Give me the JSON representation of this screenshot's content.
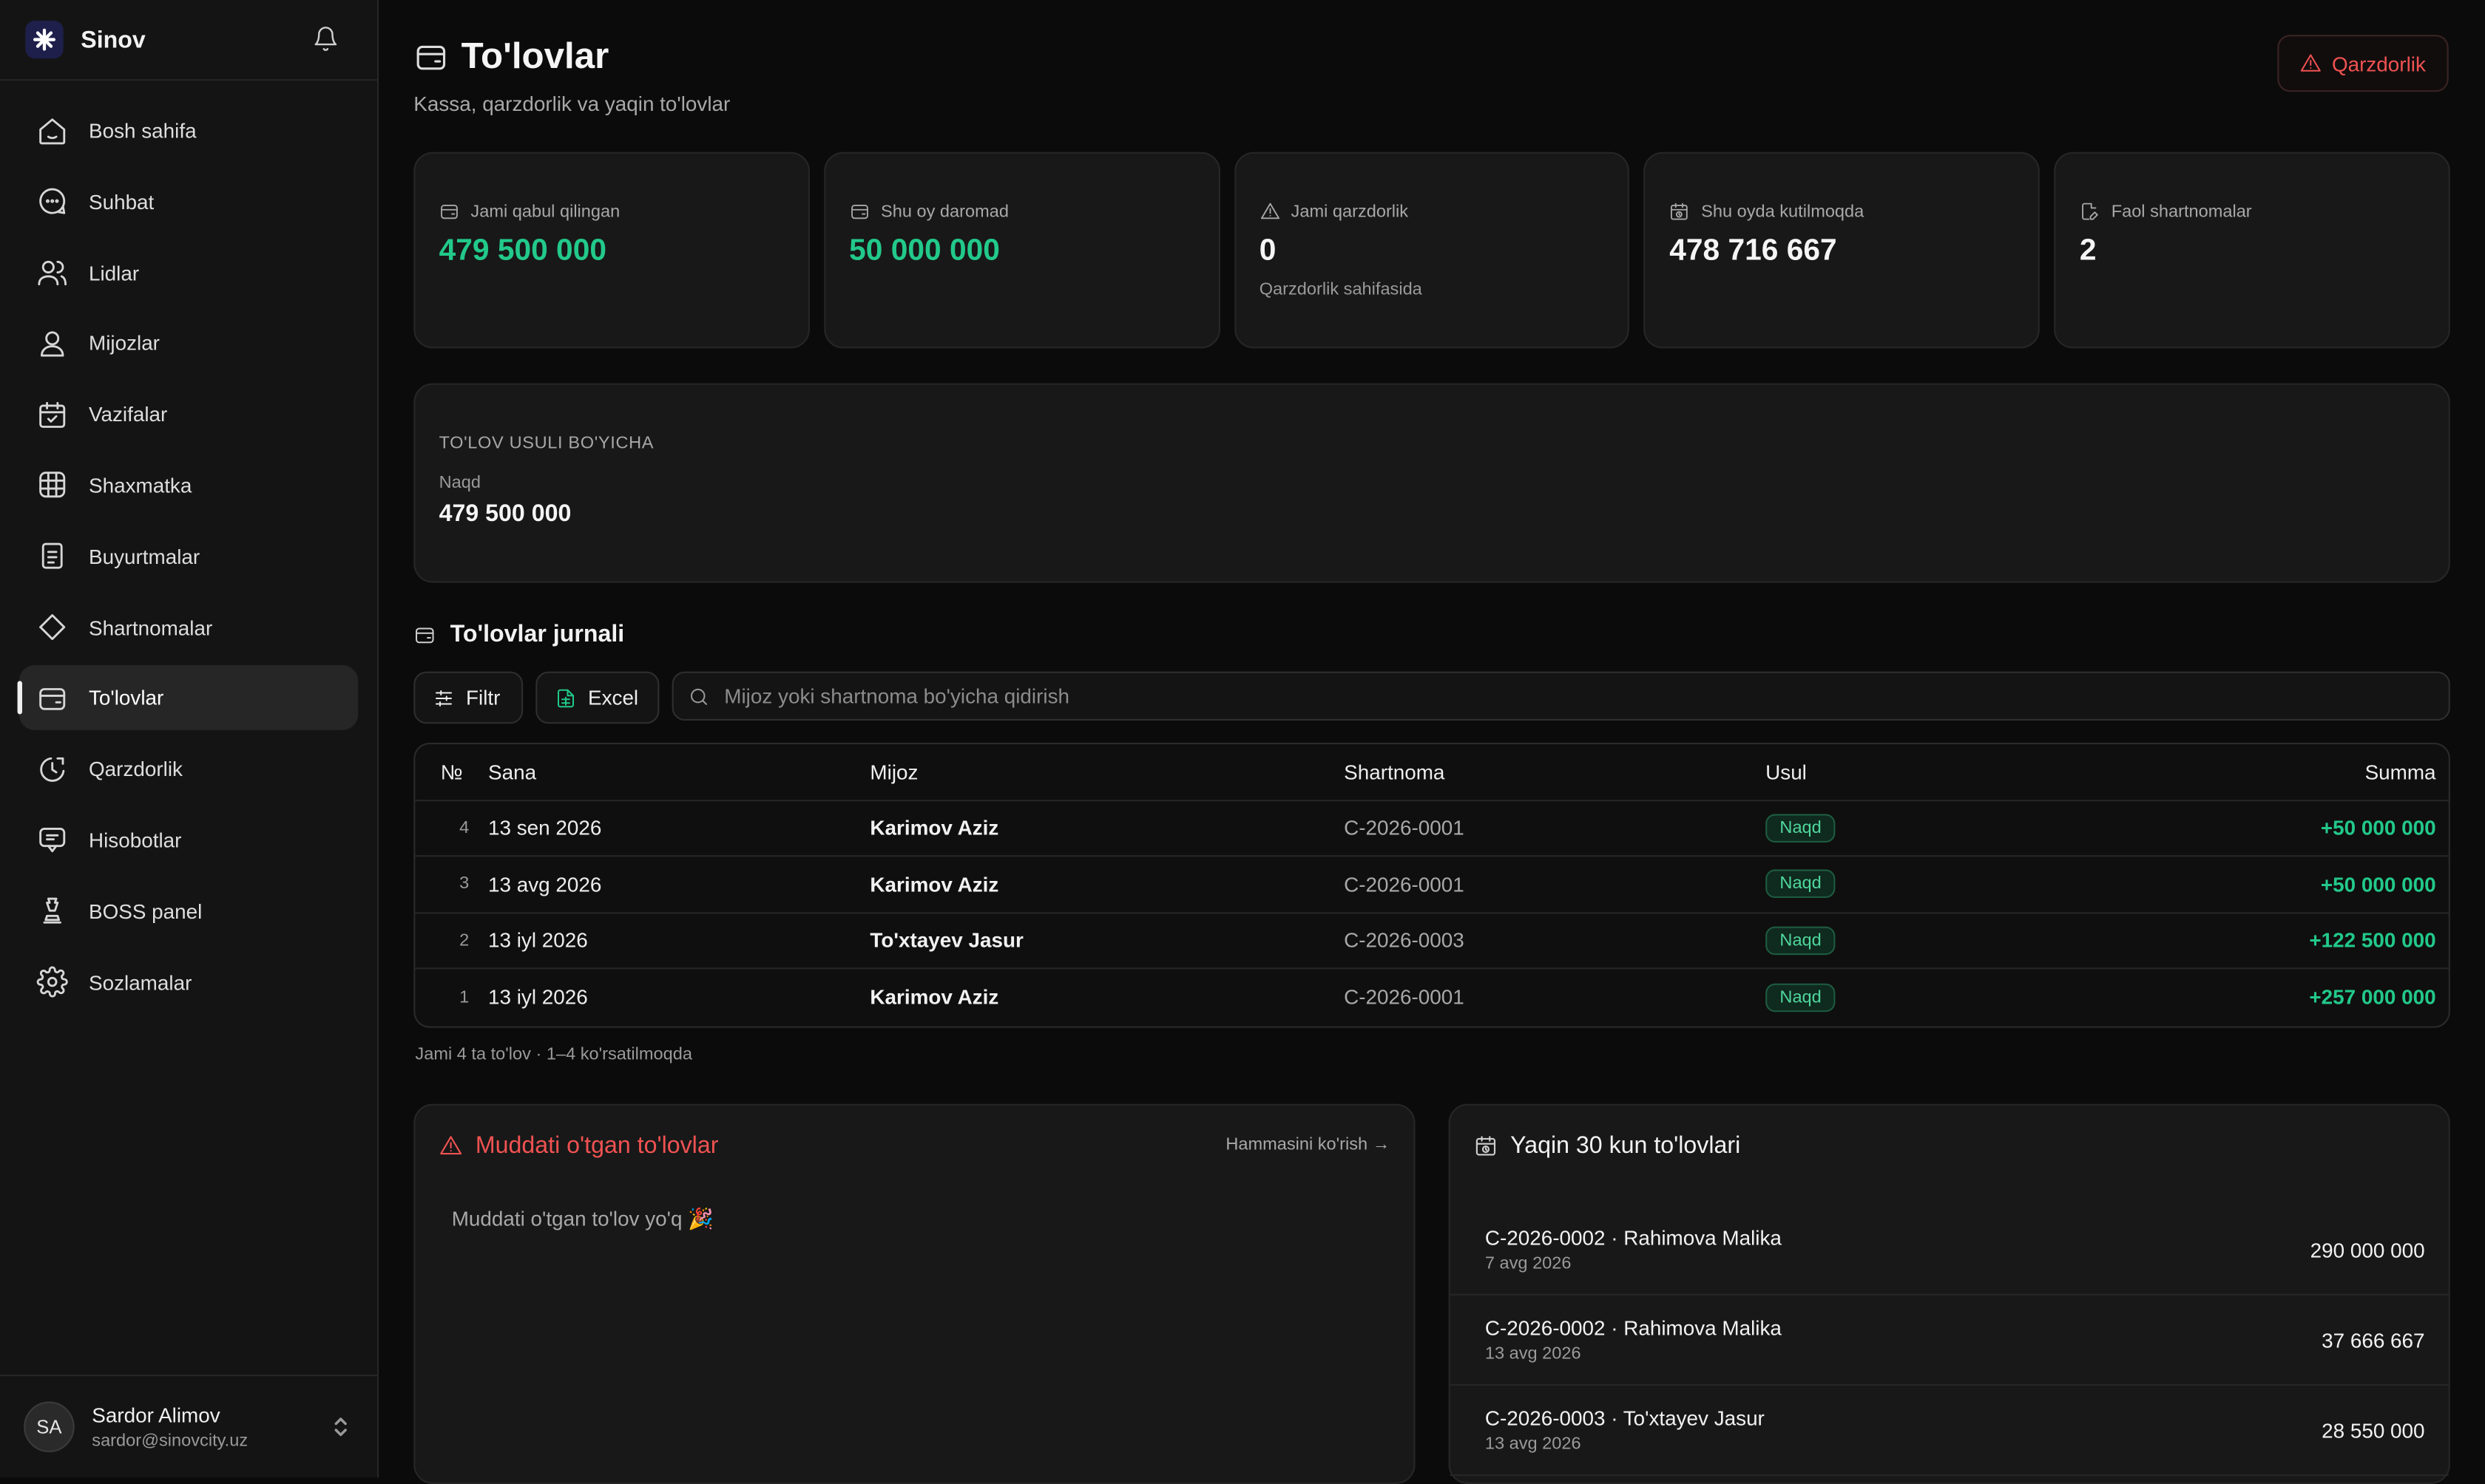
{
  "app": {
    "name": "Sinov"
  },
  "sidebar": {
    "items": [
      {
        "label": "Bosh sahifa",
        "icon": "home-icon"
      },
      {
        "label": "Suhbat",
        "icon": "chat-icon"
      },
      {
        "label": "Lidlar",
        "icon": "users-icon"
      },
      {
        "label": "Mijozlar",
        "icon": "user-icon"
      },
      {
        "label": "Vazifalar",
        "icon": "calendar-check-icon"
      },
      {
        "label": "Shaxmatka",
        "icon": "grid-icon"
      },
      {
        "label": "Buyurtmalar",
        "icon": "clipboard-icon"
      },
      {
        "label": "Shartnomalar",
        "icon": "diamond-icon"
      },
      {
        "label": "To'lovlar",
        "icon": "wallet-icon",
        "active": true
      },
      {
        "label": "Qarzdorlik",
        "icon": "clock-icon"
      },
      {
        "label": "Hisobotlar",
        "icon": "message-report-icon"
      },
      {
        "label": "BOSS panel",
        "icon": "chess-icon"
      },
      {
        "label": "Sozlamalar",
        "icon": "gear-icon"
      }
    ]
  },
  "user": {
    "initials": "SA",
    "name": "Sardor Alimov",
    "email": "sardor@sinovcity.uz"
  },
  "page": {
    "title": "To'lovlar",
    "subtitle": "Kassa, qarzdorlik va yaqin to'lovlar",
    "debt_button": "Qarzdorlik"
  },
  "stats": [
    {
      "label": "Jami qabul qilingan",
      "value": "479 500 000",
      "icon": "wallet-icon",
      "green": true
    },
    {
      "label": "Shu oy daromad",
      "value": "50 000 000",
      "icon": "wallet-icon",
      "green": true
    },
    {
      "label": "Jami qarzdorlik",
      "value": "0",
      "note": "Qarzdorlik sahifasida",
      "icon": "alert-triangle-icon",
      "green": false
    },
    {
      "label": "Shu oyda kutilmoqda",
      "value": "478 716 667",
      "icon": "calendar-clock-icon",
      "green": false
    },
    {
      "label": "Faol shartnomalar",
      "value": "2",
      "icon": "file-edit-icon",
      "green": false
    }
  ],
  "methods": {
    "title": "TO'LOV USULI BO'YICHA",
    "label": "Naqd",
    "value": "479 500 000"
  },
  "journal": {
    "title": "To'lovlar jurnali",
    "filter_label": "Filtr",
    "excel_label": "Excel",
    "search_placeholder": "Mijoz yoki shartnoma bo'yicha qidirish",
    "columns": {
      "no": "№",
      "date": "Sana",
      "client": "Mijoz",
      "contract": "Shartnoma",
      "method": "Usul",
      "sum": "Summa"
    },
    "rows": [
      {
        "no": "4",
        "date": "13 sen 2026",
        "client": "Karimov Aziz",
        "contract": "C-2026-0001",
        "method": "Naqd",
        "sum": "+50 000 000"
      },
      {
        "no": "3",
        "date": "13 avg 2026",
        "client": "Karimov Aziz",
        "contract": "C-2026-0001",
        "method": "Naqd",
        "sum": "+50 000 000"
      },
      {
        "no": "2",
        "date": "13 iyl 2026",
        "client": "To'xtayev Jasur",
        "contract": "C-2026-0003",
        "method": "Naqd",
        "sum": "+122 500 000"
      },
      {
        "no": "1",
        "date": "13 iyl 2026",
        "client": "Karimov Aziz",
        "contract": "C-2026-0001",
        "method": "Naqd",
        "sum": "+257 000 000"
      }
    ],
    "footer": "Jami 4 ta to'lov · 1–4 ko'rsatilmoqda"
  },
  "overdue": {
    "title": "Muddati o'tgan to'lovlar",
    "see_all": "Hammasini ko'rish →",
    "empty": "Muddati o'tgan to'lov yo'q 🎉"
  },
  "upcoming": {
    "title": "Yaqin 30 kun to'lovlari",
    "items": [
      {
        "title": "C-2026-0002 · Rahimova Malika",
        "date": "7 avg 2026",
        "amount": "290 000 000"
      },
      {
        "title": "C-2026-0002 · Rahimova Malika",
        "date": "13 avg 2026",
        "amount": "37 666 667"
      },
      {
        "title": "C-2026-0003 · To'xtayev Jasur",
        "date": "13 avg 2026",
        "amount": "28 550 000"
      }
    ]
  },
  "colors": {
    "accent_green": "#22c98a",
    "danger_red": "#f05252",
    "background": "#0b0b0b",
    "card": "#181818"
  }
}
